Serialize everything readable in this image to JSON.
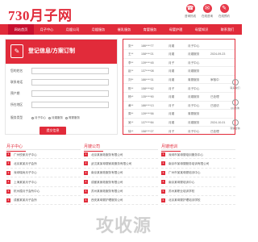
{
  "header": {
    "logo": "730月子网",
    "icons": [
      {
        "label": "咨询热线",
        "glyph": "☎",
        "name": "hotline-icon"
      },
      {
        "label": "在线咨询",
        "glyph": "✉",
        "name": "chat-icon"
      },
      {
        "label": "在线预约",
        "glyph": "✎",
        "name": "booking-icon"
      }
    ]
  },
  "nav": {
    "items": [
      "网站首页",
      "月子中心",
      "月嫂公司",
      "月嫂服务",
      "催乳服务",
      "育婴服务",
      "母婴护理",
      "母婴知识",
      "联系我们"
    ]
  },
  "form": {
    "title": "登记信息/方案订制",
    "icon": "✎",
    "fields": [
      {
        "label": "您的姓名",
        "placeholder": ""
      },
      {
        "label": "联系电话",
        "placeholder": ""
      },
      {
        "label": "预产期",
        "placeholder": ""
      },
      {
        "label": "所在地区",
        "placeholder": ""
      }
    ],
    "service_label": "服务类型",
    "radios": [
      "月子中心",
      "月嫂服务",
      "育婴服务"
    ],
    "submit": "提交信息"
  },
  "list": {
    "rows": [
      [
        "张**",
        "186****77",
        "月嫂",
        "月子中心",
        ""
      ],
      [
        "王**",
        "158****21",
        "月嫂",
        "月嫂服务",
        "2024-09-23"
      ],
      [
        "李**",
        "139****45",
        "月子",
        "月子中心",
        ""
      ],
      [
        "赵**",
        "137****08",
        "月嫂",
        "月嫂服务",
        ""
      ],
      [
        "刘**",
        "186****31",
        "月嫂",
        "育婴服务",
        "审核中"
      ],
      [
        "陈**",
        "158****62",
        "月子",
        "月子中心",
        ""
      ],
      [
        "杨**",
        "135****90",
        "月嫂",
        "月嫂服务",
        "已处理"
      ],
      [
        "黄**",
        "186****13",
        "月子",
        "月子中心",
        "已回访"
      ],
      [
        "周**",
        "139****56",
        "月嫂",
        "育婴服务",
        ""
      ],
      [
        "吴**",
        "137****84",
        "月嫂",
        "月嫂服务",
        "2024-10-01"
      ],
      [
        "徐**",
        "158****27",
        "月子",
        "月子中心",
        "已处理"
      ]
    ]
  },
  "side": {
    "items": [
      {
        "label": "联系我们",
        "name": "contact-icon"
      },
      {
        "label": "QQ咨询",
        "name": "qq-icon"
      },
      {
        "label": "微信咨询",
        "name": "wechat-icon"
      }
    ]
  },
  "columns": [
    {
      "title": "月子中心",
      "items": [
        "广州悦家月子中心",
        "北京某某月子会所",
        "深圳瑞尚月子中心",
        "上海某某月子中心",
        "杭州禧月子会所中心",
        "成都某某月子会所"
      ]
    },
    {
      "title": "月嫂公司",
      "items": [
        "北京某家政服务有限公司",
        "武汉某某母婴家政服务有限公司",
        "南京某家政服务有限公司",
        "成都某家政服务有限公司",
        "苏州某家政服务有限公司",
        "西安某母婴护理服务公司"
      ]
    },
    {
      "title": "月嫂培训",
      "items": [
        "深圳市某母婴培训服务中心",
        "南京市某母婴服务培训有限公司",
        "广州市某某母婴培训中心",
        "南京某母婴培训中心",
        "苏州某职业培训学校",
        "北京某母婴护理培训学校"
      ]
    }
  ],
  "watermark": "攻收源"
}
